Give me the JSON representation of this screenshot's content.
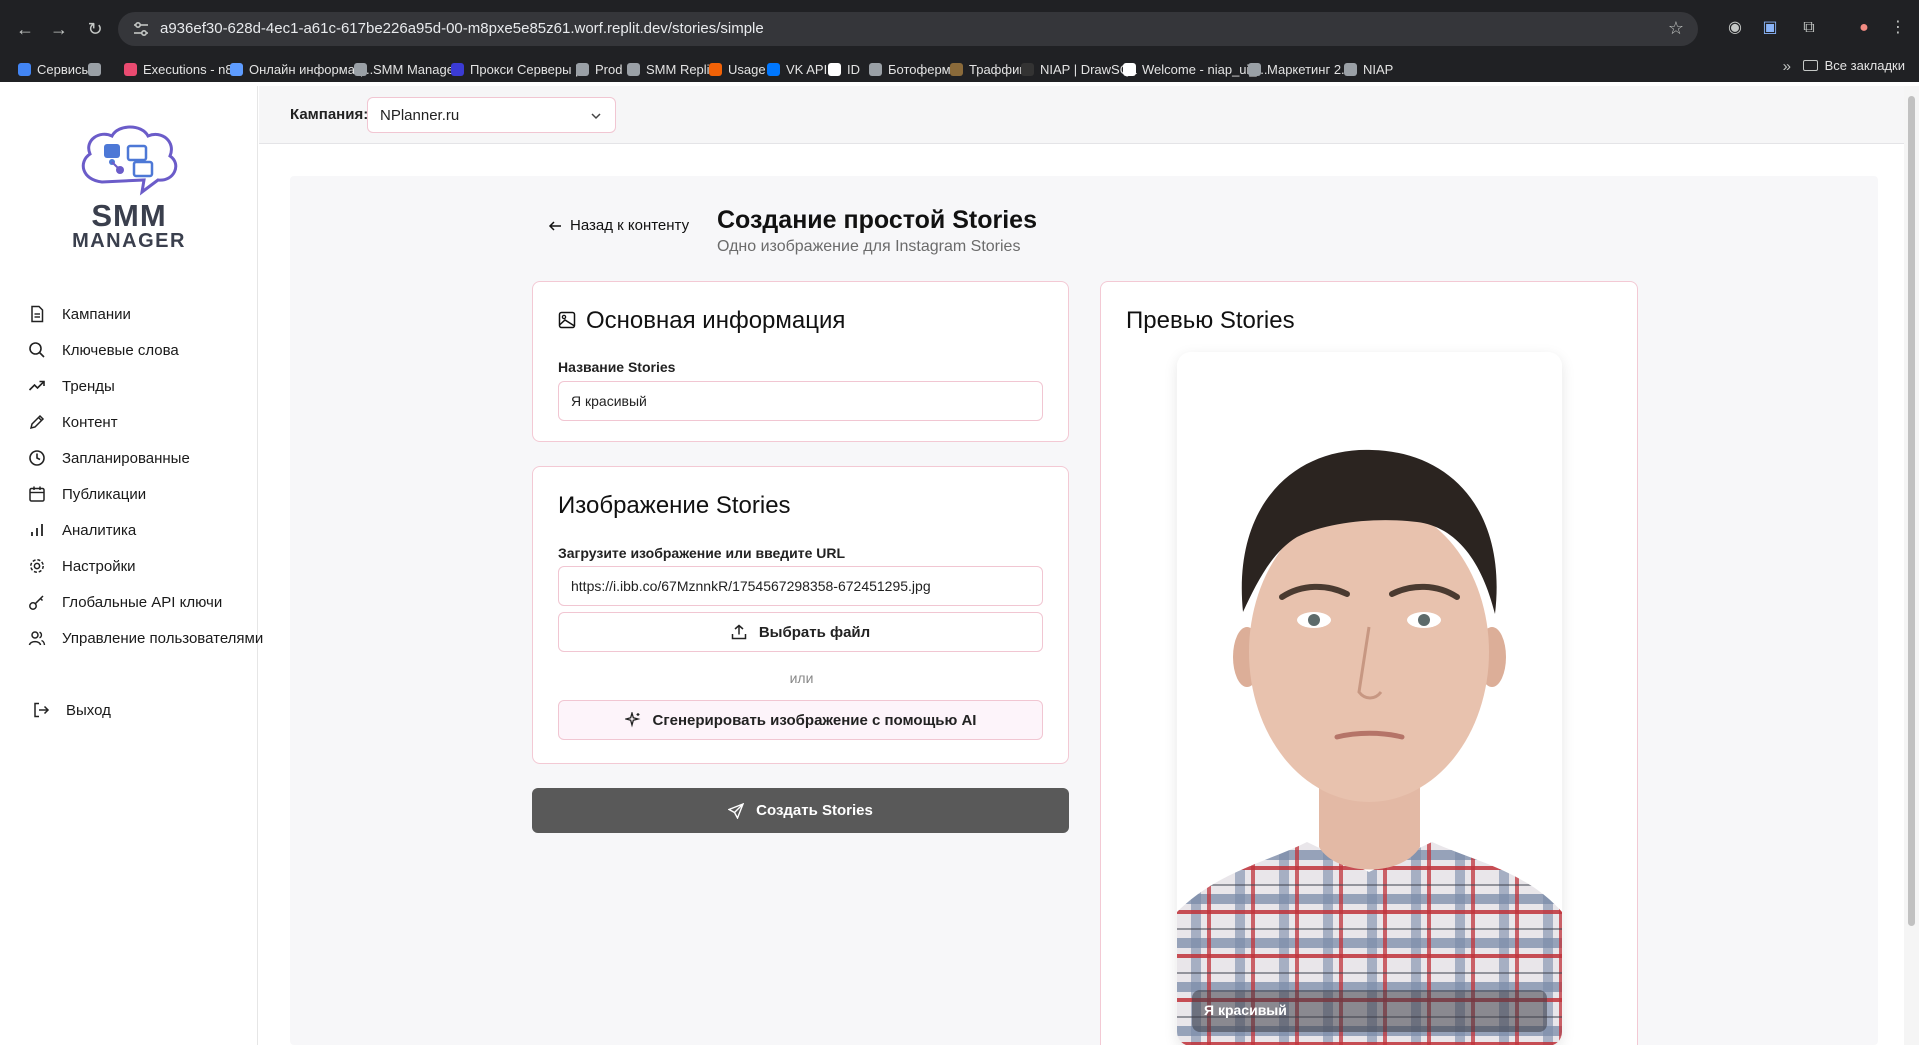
{
  "browser": {
    "url": "a936ef30-628d-4ec1-a61c-617be226a95d-00-m8pxe5e85z61.worf.replit.dev/stories/simple",
    "bookmarks": [
      {
        "label": "Сервисы",
        "color": "#4285f4"
      },
      {
        "label": "",
        "color": "#9aa0a6"
      },
      {
        "label": "Executions - n8n",
        "color": "#ea4b71"
      },
      {
        "label": "Онлайн информац...",
        "color": "#5e9cff"
      },
      {
        "label": "SMM Manager",
        "color": "#9aa0a6"
      },
      {
        "label": "Прокси Серверы |...",
        "color": "#3b3bd4"
      },
      {
        "label": "Prod",
        "color": "#9aa0a6"
      },
      {
        "label": "SMM Replit",
        "color": "#9aa0a6"
      },
      {
        "label": "Usage",
        "color": "#f26207"
      },
      {
        "label": "VK API",
        "color": "#0077ff"
      },
      {
        "label": "ID",
        "color": "#ffffff"
      },
      {
        "label": "Ботоферма",
        "color": "#9aa0a6"
      },
      {
        "label": "Траффик",
        "color": "#8a6a3a"
      },
      {
        "label": "NIAP | DrawSQL",
        "color": "#333333"
      },
      {
        "label": "Welcome - niap_ui_...",
        "color": "#ffffff"
      },
      {
        "label": "Маркетинг 2.0",
        "color": "#9aa0a6"
      },
      {
        "label": "NIAP",
        "color": "#9aa0a6"
      }
    ],
    "all_bookmarks": "Все закладки"
  },
  "brand": {
    "line1": "SMM",
    "line2": "MANAGER",
    "accent": "#6b5cc9"
  },
  "sidebar": {
    "items": [
      {
        "label": "Кампании",
        "icon": "document-icon"
      },
      {
        "label": "Ключевые слова",
        "icon": "search-icon"
      },
      {
        "label": "Тренды",
        "icon": "trending-icon"
      },
      {
        "label": "Контент",
        "icon": "edit-icon"
      },
      {
        "label": "Запланированные",
        "icon": "clock-icon"
      },
      {
        "label": "Публикации",
        "icon": "calendar-icon"
      },
      {
        "label": "Аналитика",
        "icon": "bar-chart-icon"
      },
      {
        "label": "Настройки",
        "icon": "gear-icon"
      },
      {
        "label": "Глобальные API ключи",
        "icon": "key-icon"
      },
      {
        "label": "Управление пользователями",
        "icon": "users-icon"
      }
    ],
    "logout": "Выход"
  },
  "topbar": {
    "campaign_label": "Кампания:",
    "campaign_value": "NPlanner.ru"
  },
  "page": {
    "back_label": "Назад к контенту",
    "title": "Создание простой Stories",
    "subtitle": "Одно изображение для Instagram Stories"
  },
  "basic_info": {
    "title": "Основная информация",
    "name_label": "Название Stories",
    "name_value": "Я красивый"
  },
  "image_section": {
    "title": "Изображение Stories",
    "url_label": "Загрузите изображение или введите URL",
    "url_value": "https://i.ibb.co/67MznnkR/1754567298358-672451295.jpg",
    "choose_file": "Выбрать файл",
    "or": "или",
    "generate_ai": "Сгенерировать изображение с помощью AI"
  },
  "create_button": "Создать Stories",
  "preview": {
    "title": "Превью Stories",
    "caption": "Я красивый"
  }
}
